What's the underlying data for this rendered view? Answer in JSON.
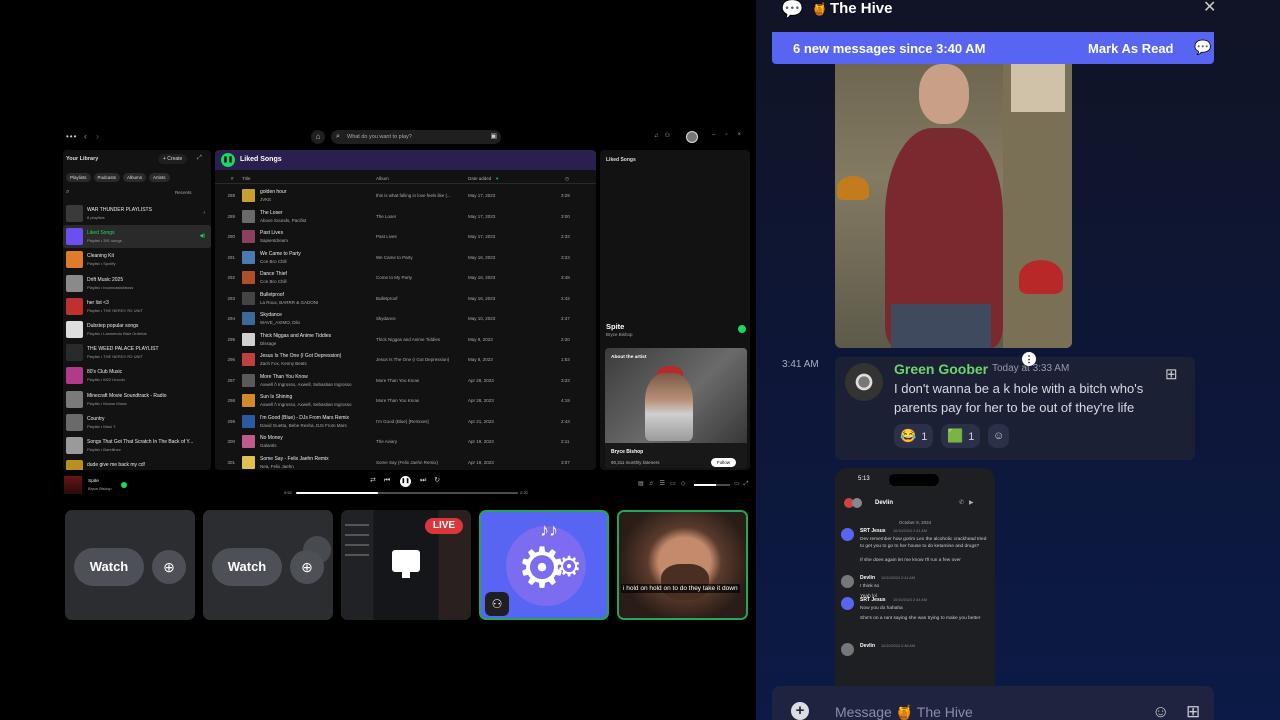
{
  "spotify": {
    "search_placeholder": "What do you want to play?",
    "library": {
      "title": "Your Library",
      "create_label": "+ Create",
      "chips": [
        "Playlists",
        "Podcasts",
        "Albums",
        "Artists"
      ],
      "sort_label": "Recents",
      "items": [
        {
          "name": "WAR THUNDER PLAYLISTS",
          "sub": "8 playlists",
          "color": "#3a3a3a"
        },
        {
          "name": "Liked Songs",
          "sub": "Playlist • 391 songs",
          "color": "#6c4ff0"
        },
        {
          "name": "Cleaning Kit",
          "sub": "Playlist • Spotify",
          "color": "#e07b2e"
        },
        {
          "name": "Drift Music 2025",
          "sub": "Playlist • boomcastsbboss",
          "color": "#8a8a8a"
        },
        {
          "name": "her list <3",
          "sub": "Playlist • THE NERDY R2 UNIT",
          "color": "#c03030"
        },
        {
          "name": "Dubstep popular songs",
          "sub": "Playlist • Lasmendo Blair Ordeñar",
          "color": "#dddddd"
        },
        {
          "name": "THE WEED PALACE PLAYLIST",
          "sub": "Playlist • THE NERDY R2 UNIT",
          "color": "#2a2a2a"
        },
        {
          "name": "80's Club Music",
          "sub": "Playlist • M22 Lincoln",
          "color": "#b23a8a"
        },
        {
          "name": "Minecraft Movie Soundtrack - Radio",
          "sub": "Playlist • Mouse Music",
          "color": "#7a7a7a"
        },
        {
          "name": "Country",
          "sub": "Playlist • Maui T.",
          "color": "#6a6a6a"
        },
        {
          "name": "Songs That Got That Scratch In The Back of Y...",
          "sub": "Playlist • Barellinez",
          "color": "#9a9a9a"
        },
        {
          "name": "dude give me back my cd!",
          "sub": "",
          "color": "#b89020"
        }
      ]
    },
    "liked": {
      "title": "Liked Songs",
      "columns": [
        "#",
        "Title",
        "Album",
        "Date added"
      ],
      "tracks": [
        {
          "n": "288",
          "title": "golden hour",
          "artist": "JVKE",
          "album": "this is what falling in love feels like (...",
          "date": "May 17, 2023",
          "dur": "3:29",
          "color": "#c9a030"
        },
        {
          "n": "289",
          "title": "The Loser",
          "artist": "Above Sounds, Pacifist",
          "album": "The Loser",
          "date": "May 17, 2023",
          "dur": "3:00",
          "color": "#6a6a6a"
        },
        {
          "n": "290",
          "title": "Past Lives",
          "artist": "Sapientdream",
          "album": "Past Lives",
          "date": "May 17, 2023",
          "dur": "2:33",
          "color": "#8a4060"
        },
        {
          "n": "291",
          "title": "We Came to Party",
          "artist": "Con Bro Chill",
          "album": "We Came to Party",
          "date": "May 16, 2023",
          "dur": "3:23",
          "color": "#4a7ab0"
        },
        {
          "n": "292",
          "title": "Dance Thief",
          "artist": "Con Bro Chill",
          "album": "Come to My Party",
          "date": "May 16, 2023",
          "dur": "3:48",
          "color": "#b0502a"
        },
        {
          "n": "293",
          "title": "Bulletproof",
          "artist": "La Roux, BARRR & GADONI",
          "album": "Bulletproof",
          "date": "May 16, 2023",
          "dur": "2:42",
          "color": "#444444"
        },
        {
          "n": "294",
          "title": "Skydance",
          "artist": "WAVE_AXIMO, Dilo",
          "album": "Skydance",
          "date": "May 10, 2023",
          "dur": "2:47",
          "color": "#3a6a9a"
        },
        {
          "n": "295",
          "title": "Thick Niggas and Anime Tiddies",
          "artist": "Dlssage",
          "album": "Thick Niggas and Anime Tiddies",
          "date": "May 9, 2023",
          "dur": "2:20",
          "color": "#d0d0d0"
        },
        {
          "n": "296",
          "title": "Jesus Is The One (I Got Depression)",
          "artist": "Zach Fox, Kenny Beats",
          "album": "Jesus Is The One (I Got Depression)",
          "date": "May 8, 2023",
          "dur": "1:53",
          "color": "#c04040"
        },
        {
          "n": "297",
          "title": "More Than You Know",
          "artist": "Axwell /\\ Ingrosso, Axwell, Sebastian Ingrosso",
          "album": "More Than You Know",
          "date": "Apr 28, 2023",
          "dur": "3:23",
          "color": "#5a5a5a"
        },
        {
          "n": "298",
          "title": "Sun Is Shining",
          "artist": "Axwell /\\ Ingrosso, Axwell, Sebastian Ingrosso",
          "album": "More Than You Know",
          "date": "Apr 28, 2023",
          "dur": "4:19",
          "color": "#d08a2a"
        },
        {
          "n": "299",
          "title": "I'm Good (Blue) - DJs From Mars Remix",
          "artist": "David Guetta, Bebe Rexha, DJs From Mars",
          "album": "I'm Good (Blue) [Remixes]",
          "date": "Apr 21, 2023",
          "dur": "2:43",
          "color": "#2a5aa0"
        },
        {
          "n": "300",
          "title": "No Money",
          "artist": "Galantis",
          "album": "The Aviary",
          "date": "Apr 19, 2023",
          "dur": "3:11",
          "color": "#c05a8a"
        },
        {
          "n": "301",
          "title": "Some Say - Felix Jaehn Remix",
          "artist": "Nea, Felix Jaehn",
          "album": "Some Say (Felix Jaehn Remix)",
          "date": "Apr 19, 2023",
          "dur": "3:07",
          "color": "#e0c050"
        }
      ]
    },
    "now_playing_panel": {
      "header": "Liked Songs",
      "song": "Spite",
      "artist": "Bryce Bishop",
      "about_label": "About the artist",
      "artist_name": "Bryce Bishop",
      "listeners": "90,311 monthly listeners",
      "follow_label": "Follow"
    },
    "player": {
      "song": "Spite",
      "artist": "Bryce Bishop",
      "elapsed": "0:52",
      "total": "2:20",
      "progress": 0.37,
      "volume": 0.6
    }
  },
  "streams": {
    "watch_label": "Watch",
    "live_label": "LIVE",
    "caption": "i hold on hold on to do they take it down"
  },
  "discord": {
    "channel": "The Hive",
    "channel_emoji": "🍯",
    "new_messages": "6 new messages since 3:40 AM",
    "mark_read": "Mark As Read",
    "message": {
      "time": "3:41 AM",
      "author": "Green Goober",
      "timestamp": "Today at 3:33 AM",
      "text": "I don't wanna be a k hole with a bitch who's parents pay for her to be out of they're life",
      "reactions": [
        {
          "emoji": "😂",
          "count": "1"
        },
        {
          "emoji": "🟩",
          "count": "1"
        }
      ]
    },
    "phone": {
      "time": "5:13",
      "contact": "Devlin",
      "date": "October 9, 2024",
      "messages": [
        {
          "author": "SRT Jesus",
          "ts": "10/10/2024 2:41 AM",
          "lines": [
            "Dev remember how gorim Lex the alcoholic crackhead tried to get you to go to her house to do ketamine and drugs?",
            "If she does again let me know I'll run a few over"
          ]
        },
        {
          "author": "Devlin",
          "ts": "10/10/2024 2:41 AM",
          "lines": [
            "I think so",
            "Yeah lol"
          ]
        },
        {
          "author": "SRT Jesus",
          "ts": "10/10/2024 2:44 AM",
          "lines": [
            "Now you do hahaha",
            "She's on a rant saying she was trying to make you better"
          ]
        },
        {
          "author": "Devlin",
          "ts": "10/10/2024 2:46 AM",
          "lines": []
        }
      ]
    },
    "composer_placeholder": "Message 🍯 The Hive"
  }
}
